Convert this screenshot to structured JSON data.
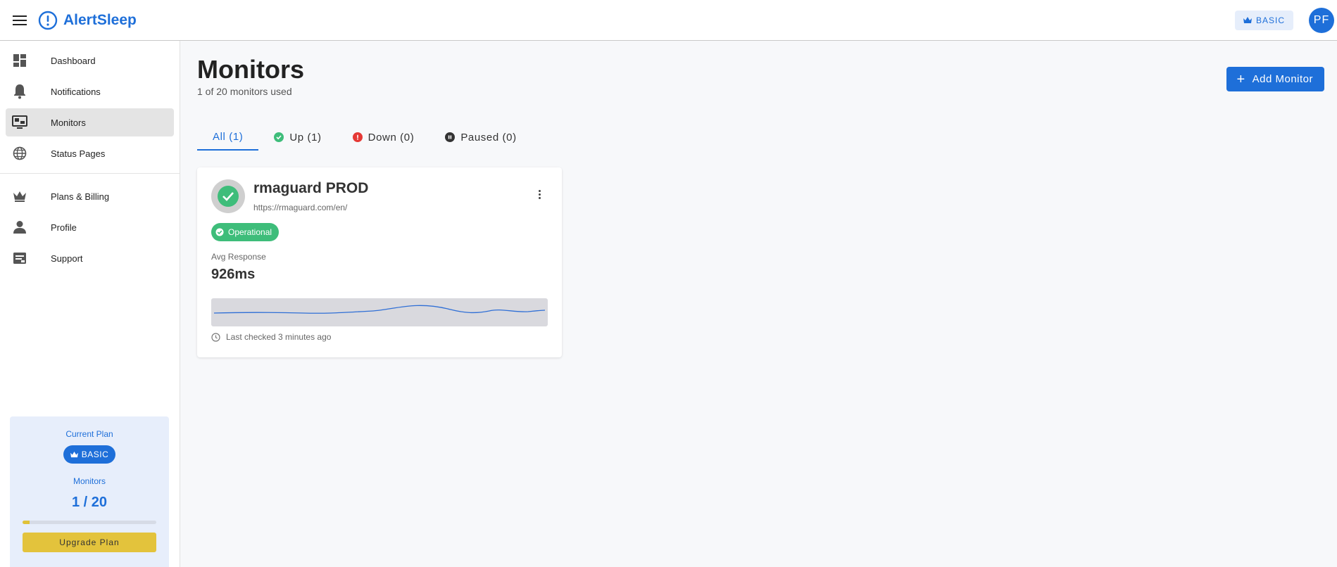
{
  "app": {
    "name": "AlertSleep",
    "plan_chip": "BASIC",
    "avatar_initials": "PF",
    "brand_color": "#1e6fd9"
  },
  "sidebar": {
    "items": [
      {
        "label": "Dashboard",
        "icon": "dashboard-icon",
        "active": false
      },
      {
        "label": "Notifications",
        "icon": "bell-icon",
        "active": false
      },
      {
        "label": "Monitors",
        "icon": "monitor-icon",
        "active": true
      },
      {
        "label": "Status Pages",
        "icon": "globe-icon",
        "active": false
      },
      {
        "label": "Plans & Billing",
        "icon": "crown-icon",
        "active": false
      },
      {
        "label": "Profile",
        "icon": "person-icon",
        "active": false
      },
      {
        "label": "Support",
        "icon": "support-icon",
        "active": false
      }
    ],
    "plan_card": {
      "current_plan_label": "Current Plan",
      "plan_name": "BASIC",
      "monitors_label": "Monitors",
      "monitors_count": "1 / 20",
      "usage_fraction": 0.05,
      "upgrade_label": "Upgrade Plan"
    }
  },
  "main": {
    "title": "Monitors",
    "subtitle": "1 of 20 monitors used",
    "add_button": "Add Monitor",
    "tabs": [
      {
        "label": "All (1)",
        "active": true,
        "icon": null
      },
      {
        "label": "Up (1)",
        "active": false,
        "icon": "check-circle-icon",
        "color": "#3ebd7a"
      },
      {
        "label": "Down (0)",
        "active": false,
        "icon": "alert-circle-icon",
        "color": "#e53935"
      },
      {
        "label": "Paused (0)",
        "active": false,
        "icon": "pause-circle-icon",
        "color": "#333333"
      }
    ],
    "monitor_card": {
      "name": "rmaguard PROD",
      "url": "https://rmaguard.com/en/",
      "status": "Operational",
      "status_color": "#3ebd7a",
      "avg_label": "Avg Response",
      "avg_value": "926ms",
      "last_checked": "Last checked 3 minutes ago"
    }
  }
}
